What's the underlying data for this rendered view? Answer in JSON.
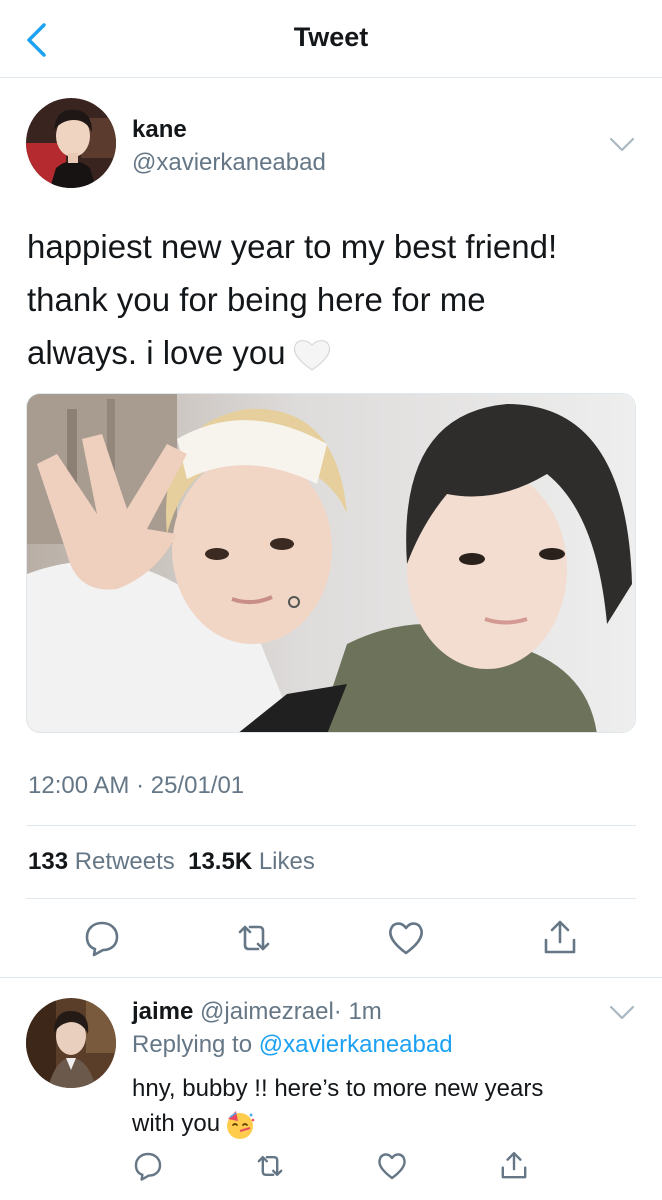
{
  "header": {
    "title": "Tweet",
    "back_icon": "chevron-left-icon"
  },
  "tweet": {
    "author": {
      "name": "kane",
      "handle": "@xavierkaneabad"
    },
    "text_lines": [
      "happiest new year to my best friend!",
      "thank you for being here for me",
      "always. i love you"
    ],
    "emoji": "white-heart-emoji",
    "timestamp": "12:00 AM · 25/01/01",
    "stats": {
      "retweets_count": "133",
      "retweets_label": "Retweets",
      "likes_count": "13.5K",
      "likes_label": "Likes"
    }
  },
  "reply": {
    "name": "jaime",
    "handle": "@jaimezrael",
    "time": "· 1m",
    "replying_label": "Replying to",
    "replying_to": "@xavierkaneabad",
    "text_lines": [
      "hny, bubby !! here’s to more new years",
      "with you"
    ],
    "emoji": "partying-face-emoji"
  },
  "colors": {
    "accent": "#1da1f2",
    "text": "#14171a",
    "secondary": "#657786",
    "border": "#e1e8ed"
  }
}
